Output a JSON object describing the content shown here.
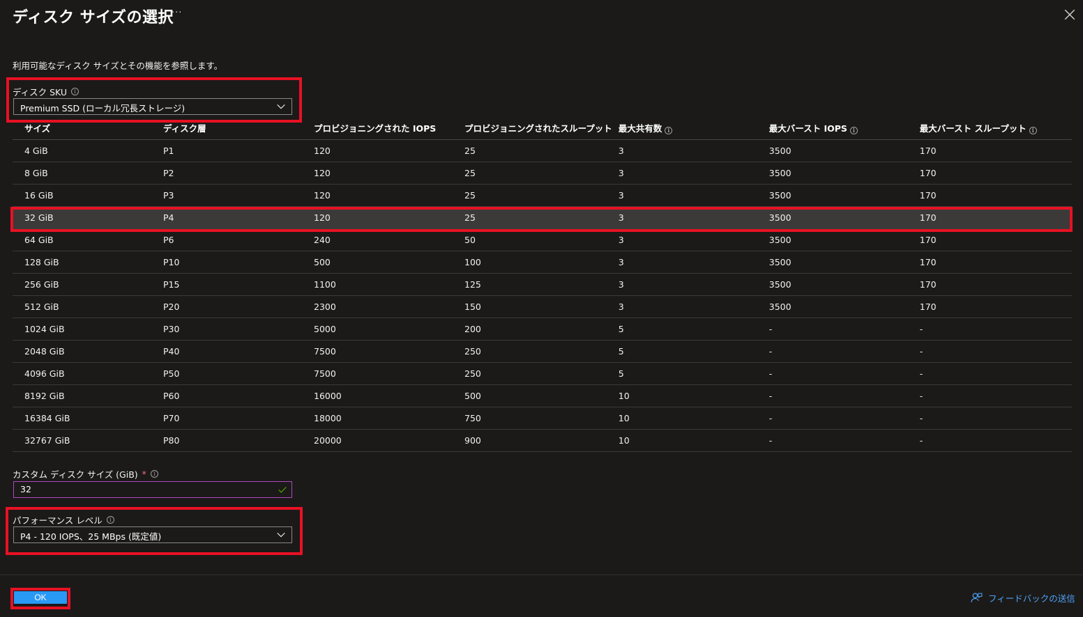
{
  "header": {
    "title": "ディスク サイズの選択",
    "more": "···"
  },
  "description": "利用可能なディスク サイズとその機能を参照します。",
  "disk_sku": {
    "label": "ディスク SKU",
    "value": "Premium SSD (ローカル冗長ストレージ)"
  },
  "table": {
    "headers": [
      "サイズ",
      "ディスク層",
      "プロビジョニングされた IOPS",
      "プロビジョニングされたスループット",
      "最大共有数",
      "最大バースト IOPS",
      "最大バースト スループット"
    ],
    "rows": [
      [
        "4 GiB",
        "P1",
        "120",
        "25",
        "3",
        "3500",
        "170"
      ],
      [
        "8 GiB",
        "P2",
        "120",
        "25",
        "3",
        "3500",
        "170"
      ],
      [
        "16 GiB",
        "P3",
        "120",
        "25",
        "3",
        "3500",
        "170"
      ],
      [
        "32 GiB",
        "P4",
        "120",
        "25",
        "3",
        "3500",
        "170"
      ],
      [
        "64 GiB",
        "P6",
        "240",
        "50",
        "3",
        "3500",
        "170"
      ],
      [
        "128 GiB",
        "P10",
        "500",
        "100",
        "3",
        "3500",
        "170"
      ],
      [
        "256 GiB",
        "P15",
        "1100",
        "125",
        "3",
        "3500",
        "170"
      ],
      [
        "512 GiB",
        "P20",
        "2300",
        "150",
        "3",
        "3500",
        "170"
      ],
      [
        "1024 GiB",
        "P30",
        "5000",
        "200",
        "5",
        "-",
        "-"
      ],
      [
        "2048 GiB",
        "P40",
        "7500",
        "250",
        "5",
        "-",
        "-"
      ],
      [
        "4096 GiB",
        "P50",
        "7500",
        "250",
        "5",
        "-",
        "-"
      ],
      [
        "8192 GiB",
        "P60",
        "16000",
        "500",
        "10",
        "-",
        "-"
      ],
      [
        "16384 GiB",
        "P70",
        "18000",
        "750",
        "10",
        "-",
        "-"
      ],
      [
        "32767 GiB",
        "P80",
        "20000",
        "900",
        "10",
        "-",
        "-"
      ]
    ],
    "selected_row": 3
  },
  "custom_size": {
    "label": "カスタム ディスク サイズ (GiB)",
    "required_mark": "*",
    "value": "32"
  },
  "performance": {
    "label": "パフォーマンス レベル",
    "value": "P4 - 120 IOPS、25 MBps (既定値)"
  },
  "footer": {
    "ok_label": "OK",
    "feedback_label": "フィードバックの送信"
  },
  "colors": {
    "background": "#1b1a19",
    "highlight": "#e81123",
    "primary_button": "#2899f5",
    "link": "#4fa3f7",
    "selected_row": "#3b3a39"
  }
}
